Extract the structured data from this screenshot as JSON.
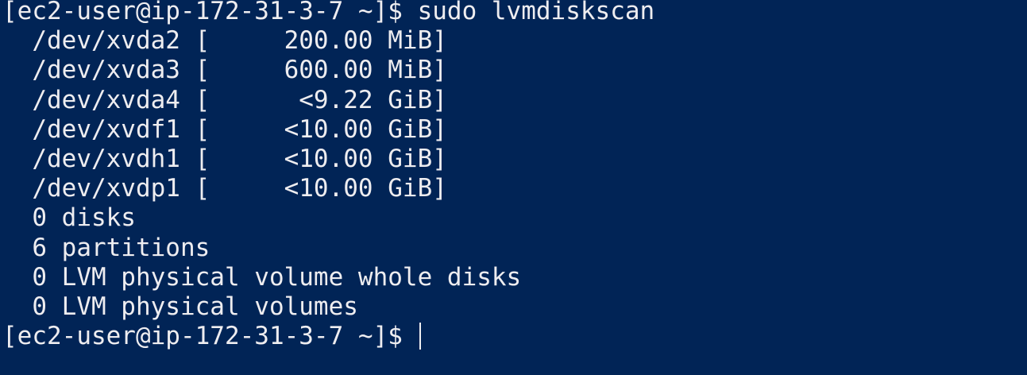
{
  "terminal": {
    "lines": [
      "[ec2-user@ip-172-31-3-7 ~]$ sudo lvmdiskscan",
      "  /dev/xvda2 [     200.00 MiB]",
      "  /dev/xvda3 [     600.00 MiB]",
      "  /dev/xvda4 [      <9.22 GiB]",
      "  /dev/xvdf1 [     <10.00 GiB]",
      "  /dev/xvdh1 [     <10.00 GiB]",
      "  /dev/xvdp1 [     <10.00 GiB]",
      "  0 disks",
      "  6 partitions",
      "  0 LVM physical volume whole disks",
      "  0 LVM physical volumes"
    ],
    "prompt": "[ec2-user@ip-172-31-3-7 ~]$ ",
    "colors": {
      "background": "#012456",
      "foreground": "#eeedf0"
    }
  }
}
